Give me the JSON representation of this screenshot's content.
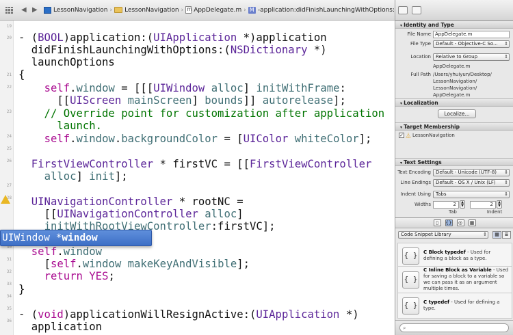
{
  "jumpbar": {
    "crumbs": [
      "LessonNavigation",
      "LessonNavigation",
      "AppDelegate.m",
      "-application:didFinishLaunchingWithOptions:"
    ],
    "method_badge": "M"
  },
  "gutter": {
    "line_numbers": [
      "19",
      "20",
      "21",
      "22",
      "23",
      "24",
      "25",
      "26",
      "27",
      "28",
      "29",
      "30",
      "31",
      "32",
      "33",
      "34",
      "35",
      "36"
    ]
  },
  "code": [
    "",
    "- (BOOL)application:(UIApplication *)application",
    "  didFinishLaunchingWithOptions:(NSDictionary *)",
    "  launchOptions",
    "{",
    "    self.window = [[[UIWindow alloc] initWithFrame:",
    "      [[UIScreen mainScreen] bounds]] autorelease];",
    "    // Override point for customization after application",
    "      launch.",
    "    self.window.backgroundColor = [UIColor whiteColor];",
    "",
    "  FirstViewController * firstVC = [[FirstViewController",
    "    alloc] init];",
    "",
    "  UINavigationController * rootNC =",
    "    [[UINavigationController alloc]",
    "    initWithRootViewController:firstVC];",
    "",
    "  self.window",
    "    [self.window makeKeyAndVisible];",
    "    return YES;",
    "}",
    "",
    "- (void)applicationWillResignActive:(UIApplication *)",
    "  application"
  ],
  "autocomplete": {
    "type": "UIWindow *",
    "name": "window"
  },
  "inspector": {
    "identity": {
      "header": "Identity and Type",
      "file_name_label": "File Name",
      "file_name": "AppDelegate.m",
      "file_type_label": "File Type",
      "file_type": "Default - Objective-C So...",
      "location_label": "Location",
      "location": "Relative to Group",
      "location_file": "AppDelegate.m",
      "full_path_label": "Full Path",
      "full_path": [
        "/Users/yhuiyun/Desktop/",
        "LessonNavigation/",
        "LessonNavigation/",
        "AppDelegate.m"
      ]
    },
    "localization": {
      "header": "Localization",
      "button": "Localize..."
    },
    "target": {
      "header": "Target Membership",
      "checkmark": "✓",
      "item": "LessonNavigation"
    },
    "text_settings": {
      "header": "Text Settings",
      "encoding_label": "Text Encoding",
      "encoding": "Default - Unicode (UTF-8)",
      "line_endings_label": "Line Endings",
      "line_endings": "Default - OS X / Unix (LF)",
      "indent_using_label": "Indent Using",
      "indent_using": "Tabs",
      "widths_label": "Widths",
      "tab_width": "2",
      "indent_width": "2",
      "tab_caption": "Tab",
      "indent_caption": "Indent"
    },
    "library": {
      "selector": "Code Snippet Library",
      "snippets": [
        {
          "icon": "{ }",
          "title": "C Block typedef",
          "desc": " - Used for defining a block as a type."
        },
        {
          "icon": "{ }",
          "title": "C Inline Block as Variable",
          "desc": " - Used for saving a block to a variable so we can pass it as an argument multiple times."
        },
        {
          "icon": "{ }",
          "title": "C typedef",
          "desc": " - Used for defining a type."
        }
      ]
    }
  }
}
